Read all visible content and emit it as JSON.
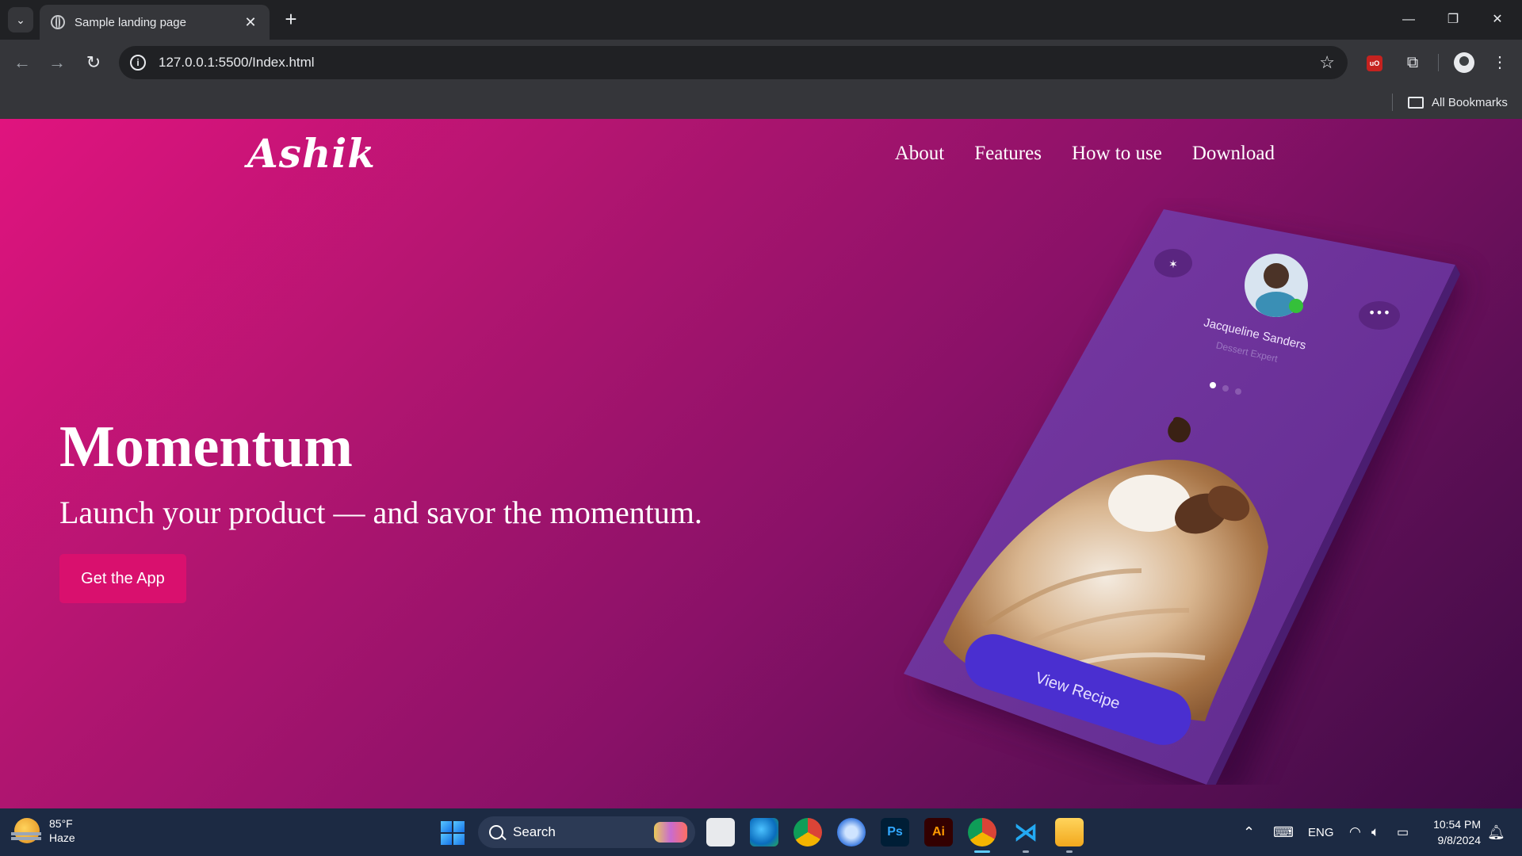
{
  "browser": {
    "tab_title": "Sample landing page",
    "tab_close": "✕",
    "new_tab": "+",
    "url": "127.0.0.1:5500/Index.html",
    "bookmarks_label": "All Bookmarks",
    "window_controls": {
      "minimize": "—",
      "restore": "❐",
      "close": "✕"
    }
  },
  "site": {
    "logo": "Ashik",
    "nav": [
      "About",
      "Features",
      "How to use",
      "Download"
    ],
    "hero_title": "Momentum",
    "hero_subtitle": "Launch your product — and savor the momentum.",
    "cta_label": "Get the App",
    "colors": {
      "gradient_start": "#e0147e",
      "gradient_end": "#3e0b45",
      "cta": "#d9106e",
      "phone": "#6a3596",
      "recipe_button": "#4a2fd0"
    }
  },
  "phone": {
    "profile_name": "Jacqueline Sanders",
    "profile_role": "Dessert Expert",
    "button_label": "View Recipe",
    "carousel_dots": 3,
    "carousel_active_index": 0
  },
  "taskbar": {
    "weather_temp": "85°F",
    "weather_condition": "Haze",
    "search_label": "Search",
    "apps": [
      "task-view",
      "edge",
      "chrome",
      "copilot",
      "photoshop",
      "illustrator",
      "chrome-profile",
      "vscode",
      "file-explorer"
    ],
    "tray_language": "ENG",
    "time": "10:54 PM",
    "date": "9/8/2024"
  }
}
